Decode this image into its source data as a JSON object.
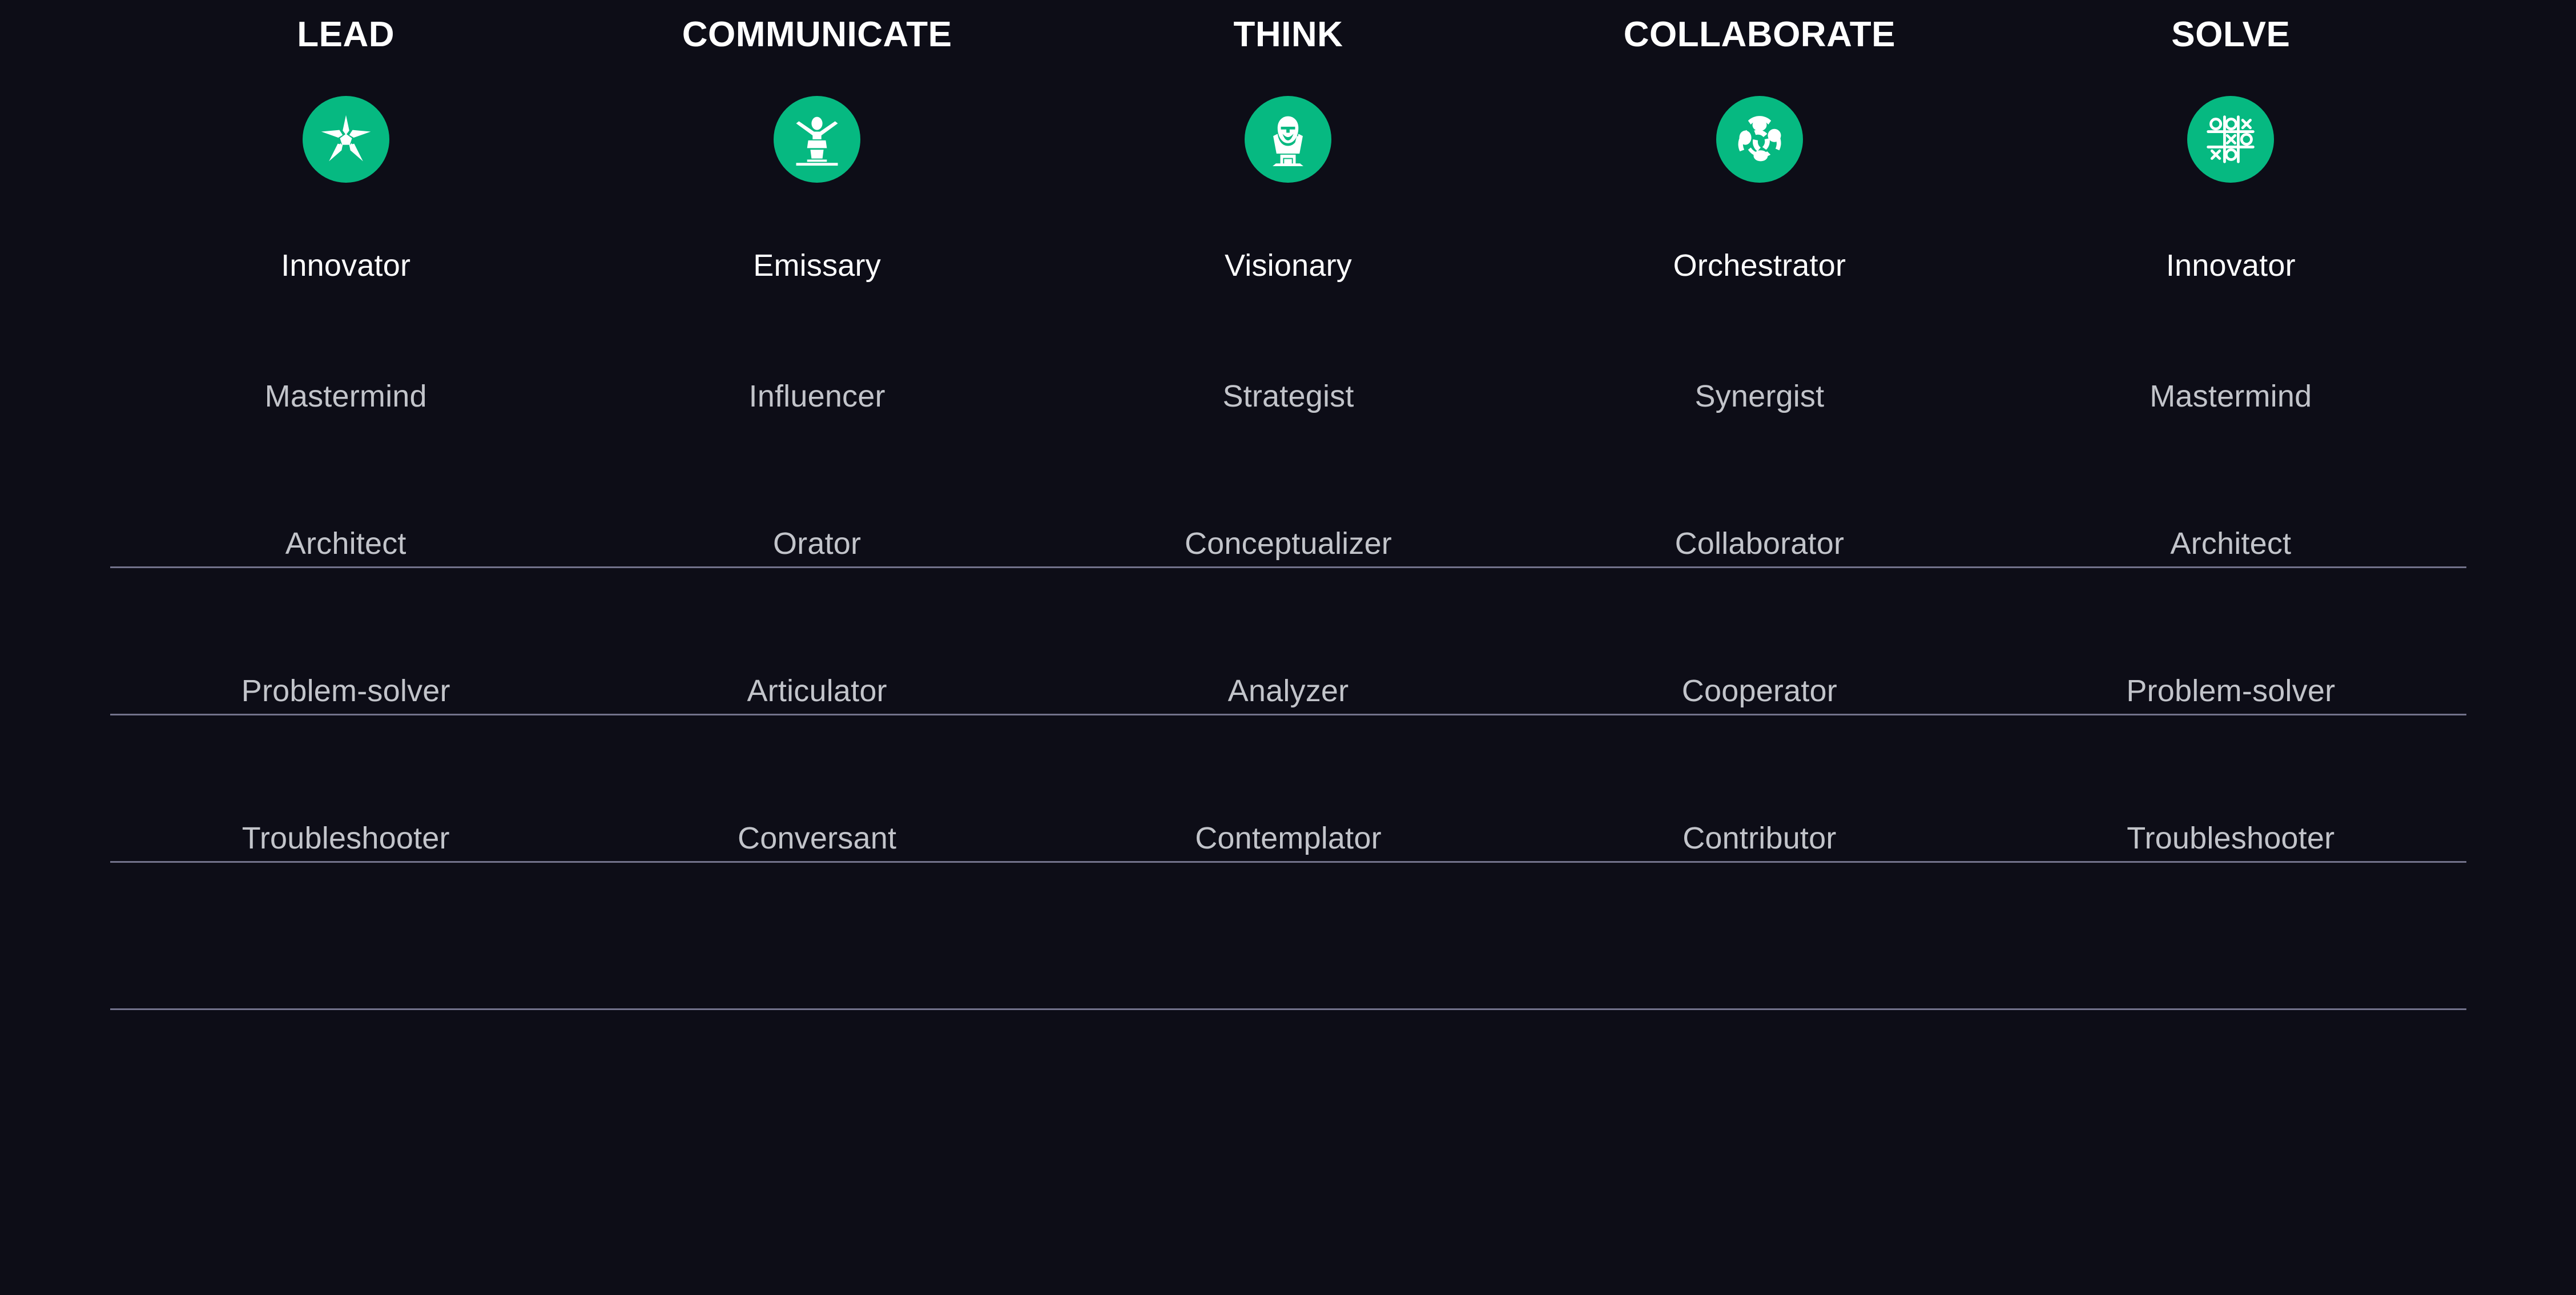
{
  "theme": {
    "background": "#0d0d17",
    "accent_green": "#06b981",
    "primary_text": "#fdfdfe",
    "secondary_text": "#c2c4ca",
    "rule_color": "#9a9ab8"
  },
  "columns": [
    {
      "header": "LEAD",
      "icon": "faceted-star-icon",
      "rows": [
        "Innovator",
        "Mastermind",
        "Architect",
        "Problem-solver",
        "Troubleshooter"
      ]
    },
    {
      "header": "COMMUNICATE",
      "icon": "podium-speaker-icon",
      "rows": [
        "Emissary",
        "Influencer",
        "Orator",
        "Articulator",
        "Conversant"
      ]
    },
    {
      "header": "THINK",
      "icon": "philosopher-bust-icon",
      "rows": [
        "Visionary",
        "Strategist",
        "Conceptualizer",
        "Analyzer",
        "Contemplator"
      ]
    },
    {
      "header": "COLLABORATE",
      "icon": "teamwork-circle-icon",
      "rows": [
        "Orchestrator",
        "Synergist",
        "Collaborator",
        "Cooperator",
        "Contributor"
      ]
    },
    {
      "header": "SOLVE",
      "icon": "tic-tac-toe-icon",
      "rows": [
        "Innovator",
        "Mastermind",
        "Architect",
        "Problem-solver",
        "Troubleshooter"
      ]
    }
  ]
}
